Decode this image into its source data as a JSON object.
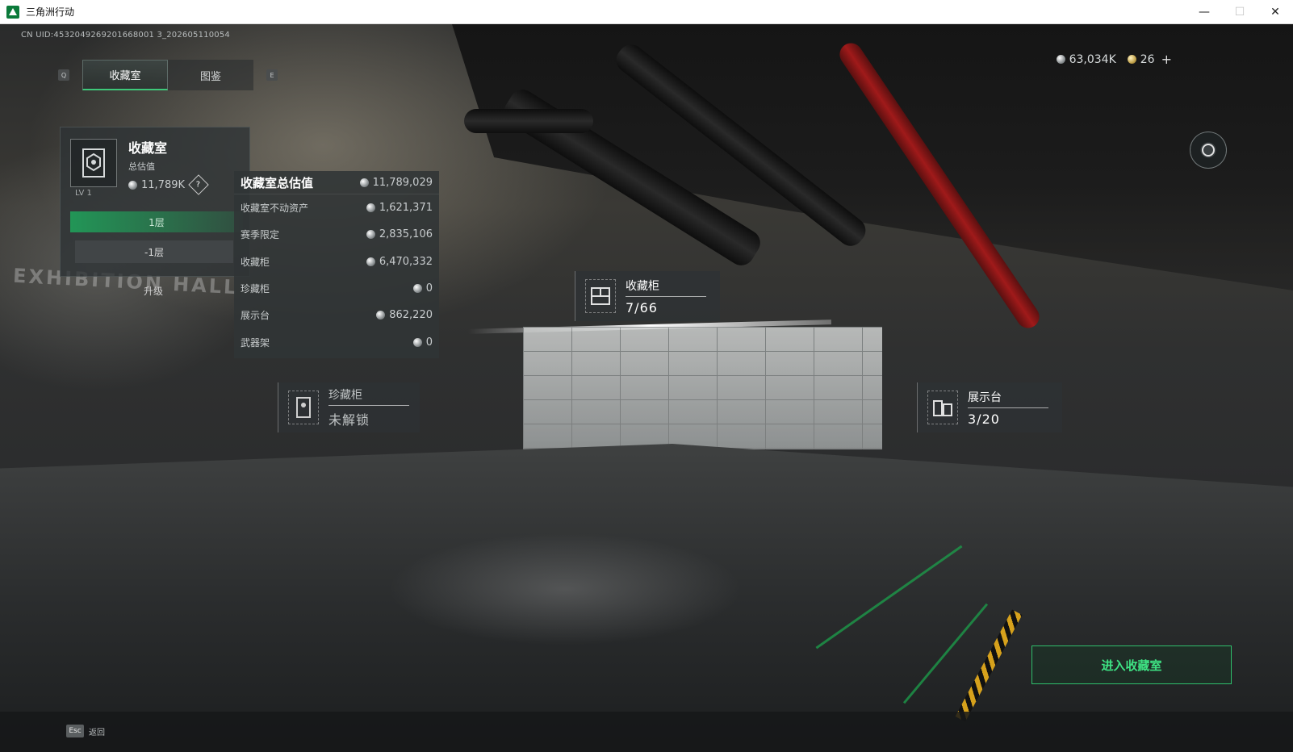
{
  "window": {
    "title": "三角洲行动",
    "minimize": "—",
    "maximize": "☐",
    "close": "✕"
  },
  "uid": "CN UID:4532049269201668001 3_202605110054",
  "tabs": {
    "prev_key": "Q",
    "next_key": "E",
    "items": [
      {
        "label": "收藏室",
        "active": true
      },
      {
        "label": "图鉴",
        "active": false
      }
    ]
  },
  "currency": {
    "coins": "63,034K",
    "tokens": "26",
    "add": "+"
  },
  "room": {
    "title": "收藏室",
    "subtitle": "总估值",
    "value": "11,789K",
    "help": "?",
    "level": "LV 1",
    "floor_active": "1层",
    "floor_other": "-1层",
    "upgrade": "升级"
  },
  "value_panel": {
    "title": "收藏室总估值",
    "total": "11,789,029",
    "rows": [
      {
        "label": "收藏室不动资产",
        "value": "1,621,371"
      },
      {
        "label": "赛季限定",
        "value": "2,835,106"
      },
      {
        "label": "收藏柜",
        "value": "6,470,332"
      },
      {
        "label": "珍藏柜",
        "value": "0"
      },
      {
        "label": "展示台",
        "value": "862,220"
      },
      {
        "label": "武器架",
        "value": "0"
      }
    ]
  },
  "scene_tags": {
    "cabinet": {
      "title": "收藏柜",
      "count": "7/66"
    },
    "treasure": {
      "title": "珍藏柜",
      "count": "未解锁"
    },
    "display": {
      "title": "展示台",
      "count": "3/20"
    }
  },
  "scene_text": {
    "hall": "EXHIBITION HALL"
  },
  "enter_button": "进入收藏室",
  "esc": {
    "key": "Esc",
    "label": "返回"
  },
  "colors": {
    "accent_green": "#3ee283",
    "panel_bg": "#303436"
  }
}
